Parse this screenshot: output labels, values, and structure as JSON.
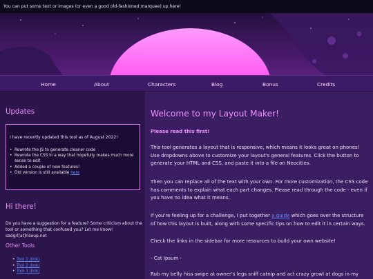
{
  "marquee": {
    "text": "You can put some text or images (or even a good old-fashioned marquee) up here!"
  },
  "banner": {
    "image": "synthwave-sunset-banner",
    "colors": {
      "sky": "#2a1246",
      "sun": "#ff4df2",
      "glow": "#c81ae0",
      "planet": "#3a1960"
    }
  },
  "nav": {
    "items": [
      {
        "label": "Home"
      },
      {
        "label": "About"
      },
      {
        "label": "Characters"
      },
      {
        "label": "Blog"
      },
      {
        "label": "Bonus"
      },
      {
        "label": "Credits"
      }
    ]
  },
  "sidebar": {
    "updates_title": "Updates",
    "update_box": {
      "intro": "I have recently updated this tool as of August 2022!",
      "items": [
        "Rewrote the JS to generate cleaner code",
        "Rewrote the CSS in a way that hopefully makes much more sense to edit",
        "Added a couple of new features!"
      ],
      "last_item_text": "Old version is still available ",
      "last_item_link": "here"
    },
    "hi_title": "Hi there!",
    "hi_text": "Do you have a suggestion for a feature? Some criticism about the tool or something that confused you? Let me know! sadgrl[at]riseup.net",
    "tools_title": "Other Tools",
    "tools": [
      "Tool 1 (link)",
      "Tool 2 (link)",
      "Tool 3 (link)"
    ]
  },
  "main": {
    "title": "Welcome to my Layout Maker!",
    "subtitle": "Please read this first!",
    "p1": "This tool generates a layout that is responsive, which means it looks great on phones! Use dropdowns above to customize your layout's general features. Click the button to generate your HTML and CSS, and paste it into a file on Neocities.",
    "p2": "Then you can replace all of the text with your own. For more customization, the CSS code has comments to explain what each part changes. Please read through the code - even if you have no idea what it means.",
    "p3_before": "If you're feeling up for a challenge, I put together ",
    "p3_link": "a guide",
    "p3_after": " which goes over the structure of how this layout is built, along with some specific tips on how to edit it in certain ways.",
    "p4": "Check the links in the sidebar for more resources to build your own website!",
    "p5": "- Cat Ipsum -",
    "p6": "Rub my belly hiss swipe at owner's legs sniff catnip and act crazy growl at dogs in my sleep sit on the"
  }
}
